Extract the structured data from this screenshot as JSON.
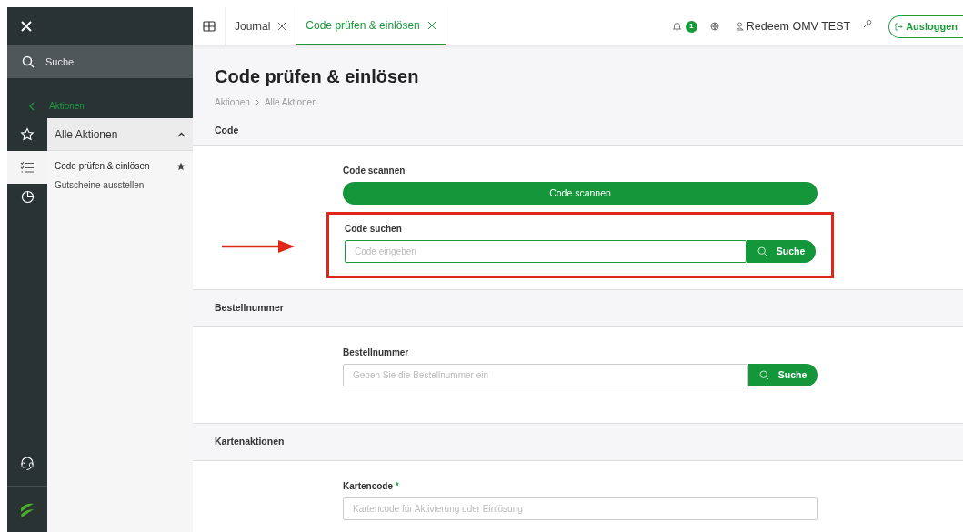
{
  "sidebar": {
    "search_placeholder": "Suche",
    "back_link": "Aktionen",
    "group": {
      "label": "Alle Aktionen",
      "expanded": true
    },
    "items": [
      {
        "label": "Code prüfen & einlösen",
        "favorite": true,
        "selected": true
      },
      {
        "label": "Gutscheine ausstellen",
        "favorite": false,
        "selected": false
      }
    ]
  },
  "tabs": [
    {
      "label": "Journal",
      "selected": false
    },
    {
      "label": "Code prüfen & einlösen",
      "selected": true
    }
  ],
  "header": {
    "notification_count": "1",
    "user": "Redeem OMV TEST",
    "logout": "Ausloggen"
  },
  "page": {
    "title": "Code prüfen & einlösen",
    "breadcrumb": [
      "Aktionen",
      "Alle Aktionen"
    ]
  },
  "sections": [
    {
      "title": "Code",
      "fields": [
        {
          "kind": "button",
          "label": "Code scannen",
          "button": "Code scannen"
        },
        {
          "kind": "search",
          "label": "Code suchen",
          "placeholder": "Code eingeben",
          "button": "Suche",
          "focused": true,
          "highlighted": true
        }
      ]
    },
    {
      "title": "Bestellnummer",
      "fields": [
        {
          "kind": "search",
          "label": "Bestellnummer",
          "placeholder": "Geben Sie die Bestellnummer ein",
          "button": "Suche",
          "focused": false,
          "highlighted": false
        }
      ]
    },
    {
      "title": "Kartenaktionen",
      "fields": [
        {
          "kind": "input",
          "label": "Kartencode",
          "required_mark": "*",
          "placeholder": "Kartencode für Aktivierung oder Einlösung"
        }
      ]
    }
  ]
}
